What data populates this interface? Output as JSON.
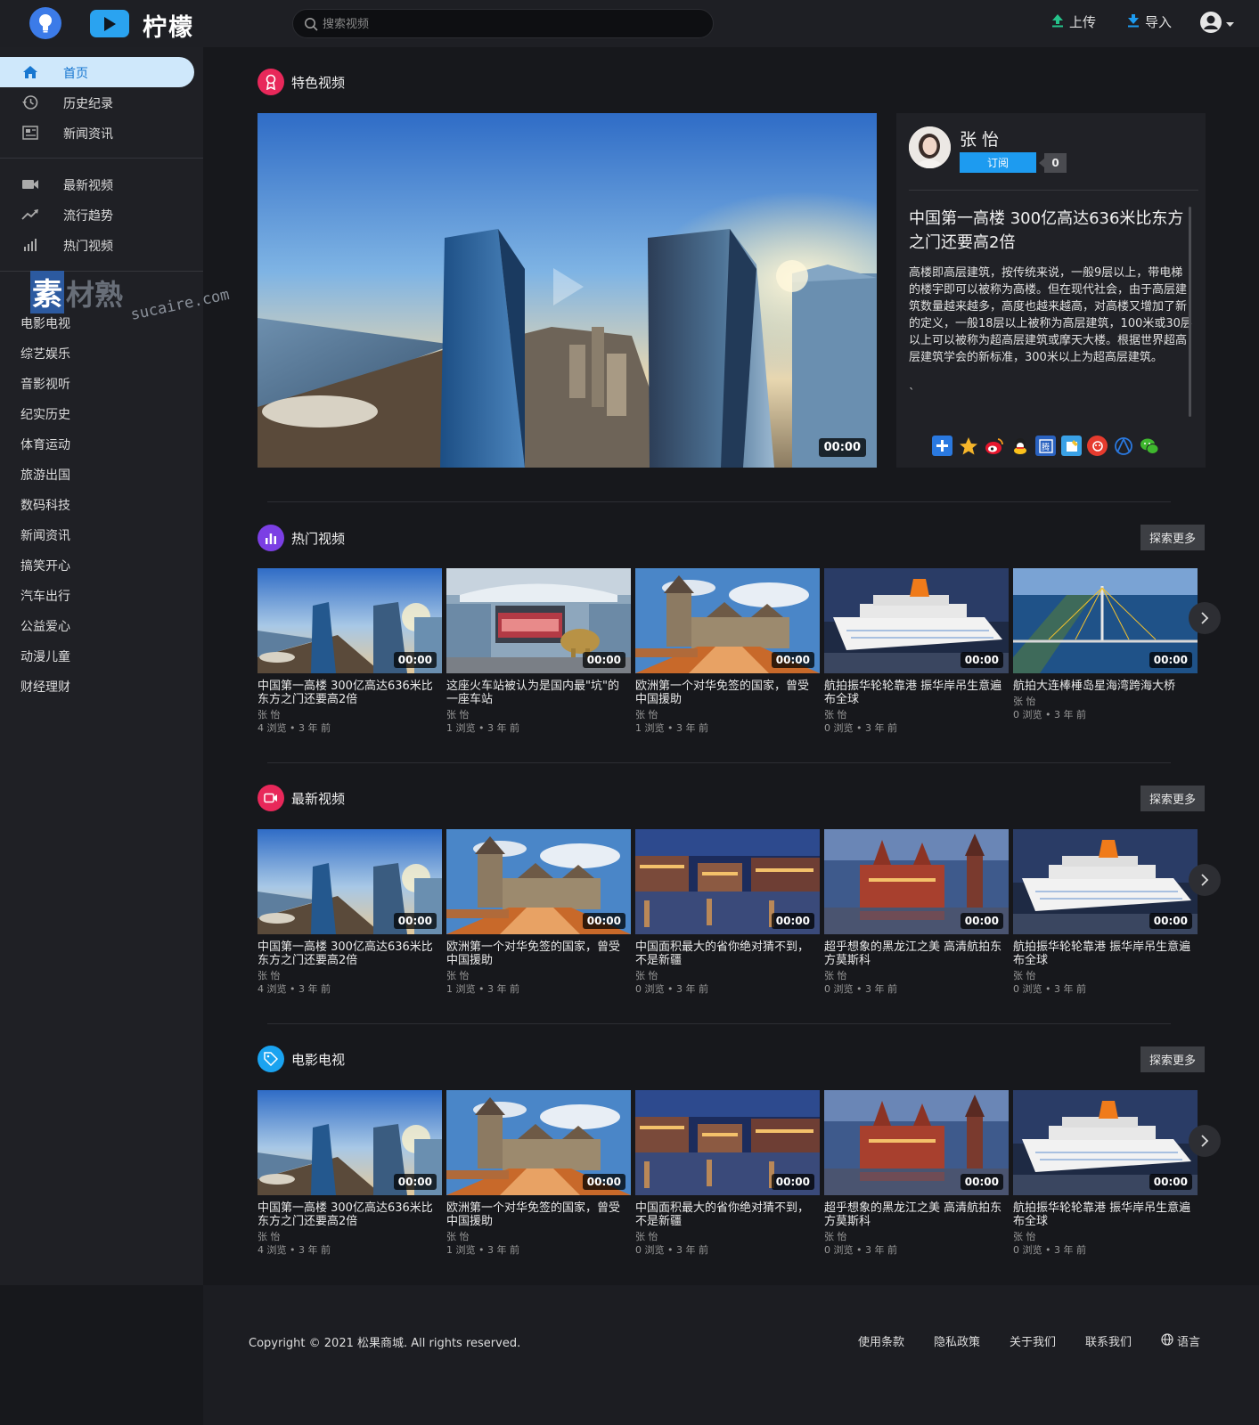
{
  "header": {
    "brand": "柠檬",
    "search_placeholder": "搜索视频",
    "upload_label": "上传",
    "import_label": "导入"
  },
  "sidebar": {
    "main_nav": [
      "首页",
      "历史纪录",
      "新闻资讯"
    ],
    "secondary_nav": [
      "最新视频",
      "流行趋势",
      "热门视频"
    ],
    "categories": [
      "电影电视",
      "综艺娱乐",
      "音影视听",
      "纪实历史",
      "体育运动",
      "旅游出国",
      "数码科技",
      "新闻资讯",
      "搞笑开心",
      "汽车出行",
      "公益爱心",
      "动漫儿童",
      "财经理财"
    ],
    "watermark_text": "素材熟",
    "watermark_url": "sucaire.com"
  },
  "featured": {
    "section_title": "特色视频",
    "duration": "00:00",
    "author": "张 怡",
    "subscribe_label": "订阅",
    "subscriber_count": "0",
    "title": "中国第一高楼 300亿高达636米比东方之门还要高2倍",
    "description": "高楼即高层建筑，按传统来说，一般9层以上，带电梯的楼宇即可以被称为高楼。但在现代社会，由于高层建筑数量越来越多，高度也越来越高，对高楼又增加了新的定义，一般18层以上被称为高层建筑，100米或30层以上可以被称为超高层建筑或摩天大楼。根据世界超高层建筑学会的新标准，300米以上为超高层建筑。",
    "trailing_mark": "`"
  },
  "more_label": "探索更多",
  "sections": [
    {
      "title": "热门视频",
      "videos": [
        {
          "title": "中国第一高楼 300亿高达636米比东方之门还要高2倍",
          "author": "张 怡",
          "stats": "4 浏览 • 3 年 前",
          "duration": "00:00",
          "thumb": "city"
        },
        {
          "title": "这座火车站被认为是国内最\"坑\"的一座车站",
          "author": "张 怡",
          "stats": "1 浏览 • 3 年 前",
          "duration": "00:00",
          "thumb": "station"
        },
        {
          "title": "欧洲第一个对华免签的国家，曾受中国援助",
          "author": "张 怡",
          "stats": "1 浏览 • 3 年 前",
          "duration": "00:00",
          "thumb": "castle"
        },
        {
          "title": "航拍振华轮轮靠港 振华岸吊生意遍布全球",
          "author": "张 怡",
          "stats": "0 浏览 • 3 年 前",
          "duration": "00:00",
          "thumb": "ship"
        },
        {
          "title": "航拍大连棒棰岛星海湾跨海大桥",
          "author": "张 怡",
          "stats": "0 浏览 • 3 年 前",
          "duration": "00:00",
          "thumb": "bridge"
        }
      ]
    },
    {
      "title": "最新视频",
      "videos": [
        {
          "title": "中国第一高楼 300亿高达636米比东方之门还要高2倍",
          "author": "张 怡",
          "stats": "4 浏览 • 3 年 前",
          "duration": "00:00",
          "thumb": "city"
        },
        {
          "title": "欧洲第一个对华免签的国家，曾受中国援助",
          "author": "张 怡",
          "stats": "1 浏览 • 3 年 前",
          "duration": "00:00",
          "thumb": "castle"
        },
        {
          "title": "中国面积最大的省你绝对猜不到，不是新疆",
          "author": "张 怡",
          "stats": "0 浏览 • 3 年 前",
          "duration": "00:00",
          "thumb": "night"
        },
        {
          "title": "超乎想象的黑龙江之美 高清航拍东方莫斯科",
          "author": "张 怡",
          "stats": "0 浏览 • 3 年 前",
          "duration": "00:00",
          "thumb": "kremlin"
        },
        {
          "title": "航拍振华轮轮靠港 振华岸吊生意遍布全球",
          "author": "张 怡",
          "stats": "0 浏览 • 3 年 前",
          "duration": "00:00",
          "thumb": "ship"
        }
      ]
    },
    {
      "title": "电影电视",
      "videos": [
        {
          "title": "中国第一高楼 300亿高达636米比东方之门还要高2倍",
          "author": "张 怡",
          "stats": "4 浏览 • 3 年 前",
          "duration": "00:00",
          "thumb": "city"
        },
        {
          "title": "欧洲第一个对华免签的国家，曾受中国援助",
          "author": "张 怡",
          "stats": "1 浏览 • 3 年 前",
          "duration": "00:00",
          "thumb": "castle"
        },
        {
          "title": "中国面积最大的省你绝对猜不到，不是新疆",
          "author": "张 怡",
          "stats": "0 浏览 • 3 年 前",
          "duration": "00:00",
          "thumb": "night"
        },
        {
          "title": "超乎想象的黑龙江之美 高清航拍东方莫斯科",
          "author": "张 怡",
          "stats": "0 浏览 • 3 年 前",
          "duration": "00:00",
          "thumb": "kremlin"
        },
        {
          "title": "航拍振华轮轮靠港 振华岸吊生意遍布全球",
          "author": "张 怡",
          "stats": "0 浏览 • 3 年 前",
          "duration": "00:00",
          "thumb": "ship"
        }
      ]
    }
  ],
  "footer": {
    "copyright": "Copyright © 2021 松果商城. All rights reserved.",
    "links": [
      "使用条款",
      "隐私政策",
      "关于我们",
      "联系我们"
    ],
    "language": "语言"
  },
  "colors": {
    "accent": "#1d9bf0",
    "featured_icon": "#e8285a",
    "hot_icon": "#7b3fe4",
    "new_icon": "#e8285a",
    "movie_icon": "#1aa3f0"
  }
}
